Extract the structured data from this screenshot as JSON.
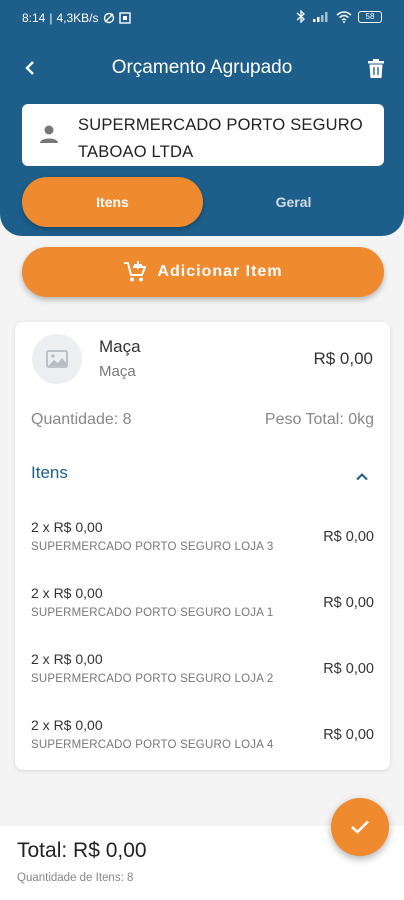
{
  "status_bar": {
    "time": "8:14",
    "net_speed": "4,3KB/s",
    "battery": "58"
  },
  "header": {
    "title": "Orçamento Agrupado"
  },
  "client": {
    "name": "SUPERMERCADO PORTO SEGURO TABOAO LTDA"
  },
  "tabs": [
    {
      "label": "Itens",
      "active": true
    },
    {
      "label": "Geral",
      "active": false
    }
  ],
  "add_button": {
    "label": "Adicionar Item"
  },
  "product": {
    "name": "Maça",
    "subtitle": "Maça",
    "price": "R$ 0,00",
    "quantity": "Quantidade: 8",
    "weight": "Peso Total: 0kg",
    "items_label": "Itens",
    "items": [
      {
        "line": "2 x R$ 0,00",
        "store": "SUPERMERCADO PORTO SEGURO LOJA 3",
        "price": "R$ 0,00"
      },
      {
        "line": "2 x R$ 0,00",
        "store": "SUPERMERCADO PORTO SEGURO LOJA 1",
        "price": "R$ 0,00"
      },
      {
        "line": "2 x R$ 0,00",
        "store": "SUPERMERCADO PORTO SEGURO LOJA 2",
        "price": "R$ 0,00"
      },
      {
        "line": "2 x R$ 0,00",
        "store": "SUPERMERCADO PORTO SEGURO LOJA 4",
        "price": "R$ 0,00"
      }
    ]
  },
  "footer": {
    "total": "Total: R$ 0,00",
    "items_count": "Quantidade de Itens: 8"
  },
  "colors": {
    "primary": "#1d5e8a",
    "accent": "#f08a2e"
  }
}
